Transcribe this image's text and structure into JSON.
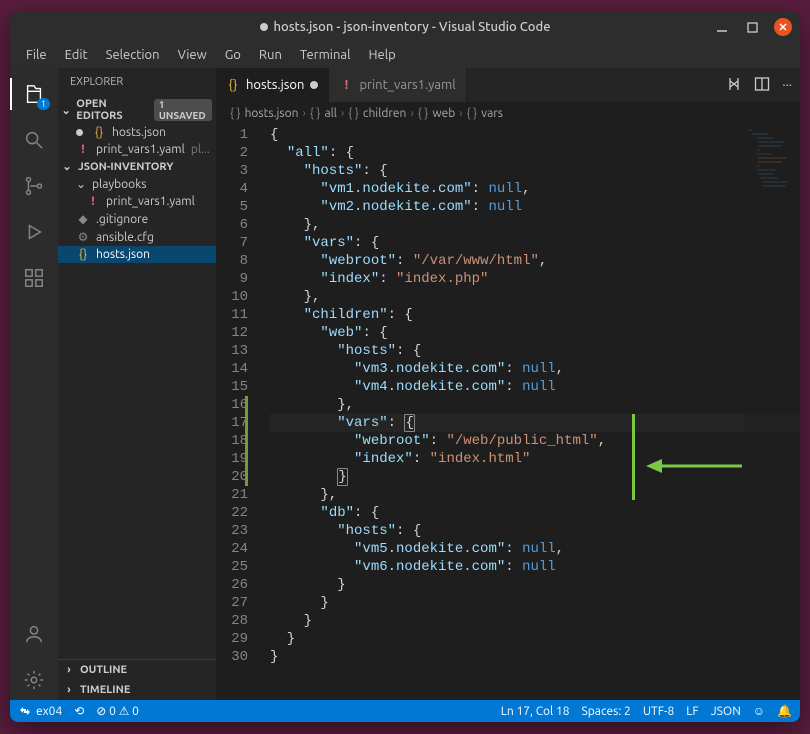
{
  "titlebar": {
    "title": "hosts.json - json-inventory - Visual Studio Code"
  },
  "menu": {
    "items": [
      "File",
      "Edit",
      "Selection",
      "View",
      "Go",
      "Run",
      "Terminal",
      "Help"
    ]
  },
  "activity": {
    "badge": "1"
  },
  "sidebar": {
    "title": "EXPLORER",
    "open_editors": {
      "label": "OPEN EDITORS",
      "unsaved": "1 UNSAVED",
      "items": [
        {
          "name": "hosts.json",
          "dirty": true,
          "icon": "{}"
        },
        {
          "name": "print_vars1.yaml",
          "hint": "pl...",
          "icon": "!"
        }
      ]
    },
    "workspace": {
      "label": "JSON-INVENTORY",
      "tree": [
        {
          "name": "playbooks",
          "type": "folder"
        },
        {
          "name": "print_vars1.yaml",
          "type": "file",
          "icon": "!",
          "depth": 1
        },
        {
          "name": ".gitignore",
          "type": "file",
          "icon": "◆",
          "depth": 0
        },
        {
          "name": "ansible.cfg",
          "type": "file",
          "icon": "⚙",
          "depth": 0
        },
        {
          "name": "hosts.json",
          "type": "file",
          "icon": "{}",
          "depth": 0,
          "active": true
        }
      ]
    },
    "outline": "OUTLINE",
    "timeline": "TIMELINE"
  },
  "tabs": {
    "items": [
      {
        "label": "hosts.json",
        "icon": "{}",
        "dirty": true,
        "active": true
      },
      {
        "label": "print_vars1.yaml",
        "icon": "!",
        "active": false
      }
    ]
  },
  "breadcrumb": {
    "segments": [
      "hosts.json",
      "all",
      "children",
      "web",
      "vars"
    ]
  },
  "editor": {
    "lines": 30,
    "tokens": [
      [
        [
          "{",
          "punc"
        ]
      ],
      [
        [
          "  ",
          ""
        ],
        [
          "\"all\"",
          "key"
        ],
        [
          ": {",
          "punc"
        ]
      ],
      [
        [
          "    ",
          ""
        ],
        [
          "\"hosts\"",
          "key"
        ],
        [
          ": {",
          "punc"
        ]
      ],
      [
        [
          "      ",
          ""
        ],
        [
          "\"vm1.nodekite.com\"",
          "key"
        ],
        [
          ": ",
          "punc"
        ],
        [
          "null",
          "null"
        ],
        [
          ",",
          "punc"
        ]
      ],
      [
        [
          "      ",
          ""
        ],
        [
          "\"vm2.nodekite.com\"",
          "key"
        ],
        [
          ": ",
          "punc"
        ],
        [
          "null",
          "null"
        ]
      ],
      [
        [
          "    },",
          "punc"
        ]
      ],
      [
        [
          "    ",
          ""
        ],
        [
          "\"vars\"",
          "key"
        ],
        [
          ": {",
          "punc"
        ]
      ],
      [
        [
          "      ",
          ""
        ],
        [
          "\"webroot\"",
          "key"
        ],
        [
          ": ",
          "punc"
        ],
        [
          "\"/var/www/html\"",
          "str"
        ],
        [
          ",",
          "punc"
        ]
      ],
      [
        [
          "      ",
          ""
        ],
        [
          "\"index\"",
          "key"
        ],
        [
          ": ",
          "punc"
        ],
        [
          "\"index.php\"",
          "str"
        ]
      ],
      [
        [
          "    },",
          "punc"
        ]
      ],
      [
        [
          "    ",
          ""
        ],
        [
          "\"children\"",
          "key"
        ],
        [
          ": {",
          "punc"
        ]
      ],
      [
        [
          "      ",
          ""
        ],
        [
          "\"web\"",
          "key"
        ],
        [
          ": {",
          "punc"
        ]
      ],
      [
        [
          "        ",
          ""
        ],
        [
          "\"hosts\"",
          "key"
        ],
        [
          ": {",
          "punc"
        ]
      ],
      [
        [
          "          ",
          ""
        ],
        [
          "\"vm3.nodekite.com\"",
          "key"
        ],
        [
          ": ",
          "punc"
        ],
        [
          "null",
          "null"
        ],
        [
          ",",
          "punc"
        ]
      ],
      [
        [
          "          ",
          ""
        ],
        [
          "\"vm4.nodekite.com\"",
          "key"
        ],
        [
          ": ",
          "punc"
        ],
        [
          "null",
          "null"
        ]
      ],
      [
        [
          "        },",
          "punc"
        ]
      ],
      [
        [
          "        ",
          ""
        ],
        [
          "\"vars\"",
          "key"
        ],
        [
          ": ",
          "punc"
        ],
        [
          "{",
          "punc",
          "m"
        ]
      ],
      [
        [
          "          ",
          ""
        ],
        [
          "\"webroot\"",
          "key"
        ],
        [
          ": ",
          "punc"
        ],
        [
          "\"/web/public_html\"",
          "str"
        ],
        [
          ",",
          "punc"
        ]
      ],
      [
        [
          "          ",
          ""
        ],
        [
          "\"index\"",
          "key"
        ],
        [
          ": ",
          "punc"
        ],
        [
          "\"index.html\"",
          "str"
        ]
      ],
      [
        [
          "        ",
          ""
        ],
        [
          "}",
          "punc",
          "m"
        ]
      ],
      [
        [
          "      },",
          "punc"
        ]
      ],
      [
        [
          "      ",
          ""
        ],
        [
          "\"db\"",
          "key"
        ],
        [
          ": {",
          "punc"
        ]
      ],
      [
        [
          "        ",
          ""
        ],
        [
          "\"hosts\"",
          "key"
        ],
        [
          ": {",
          "punc"
        ]
      ],
      [
        [
          "          ",
          ""
        ],
        [
          "\"vm5.nodekite.com\"",
          "key"
        ],
        [
          ": ",
          "punc"
        ],
        [
          "null",
          "null"
        ],
        [
          ",",
          "punc"
        ]
      ],
      [
        [
          "          ",
          ""
        ],
        [
          "\"vm6.nodekite.com\"",
          "key"
        ],
        [
          ": ",
          "punc"
        ],
        [
          "null",
          "null"
        ]
      ],
      [
        [
          "        }",
          "punc"
        ]
      ],
      [
        [
          "      }",
          "punc"
        ]
      ],
      [
        [
          "    }",
          "punc"
        ]
      ],
      [
        [
          "  }",
          "punc"
        ]
      ],
      [
        [
          "}",
          "punc"
        ]
      ]
    ],
    "highlighted_line": 17,
    "modified_lines": [
      16,
      17,
      18,
      19,
      20
    ],
    "cursor": {
      "line": 17,
      "col": 18
    }
  },
  "statusbar": {
    "remote": "ex04",
    "sync": "⟲",
    "problems": "⊘ 0 ⚠ 0",
    "cursor": "Ln 17, Col 18",
    "spaces": "Spaces: 2",
    "encoding": "UTF-8",
    "eol": "LF",
    "lang": "JSON",
    "feedback": "☺",
    "bell": "🔔"
  }
}
